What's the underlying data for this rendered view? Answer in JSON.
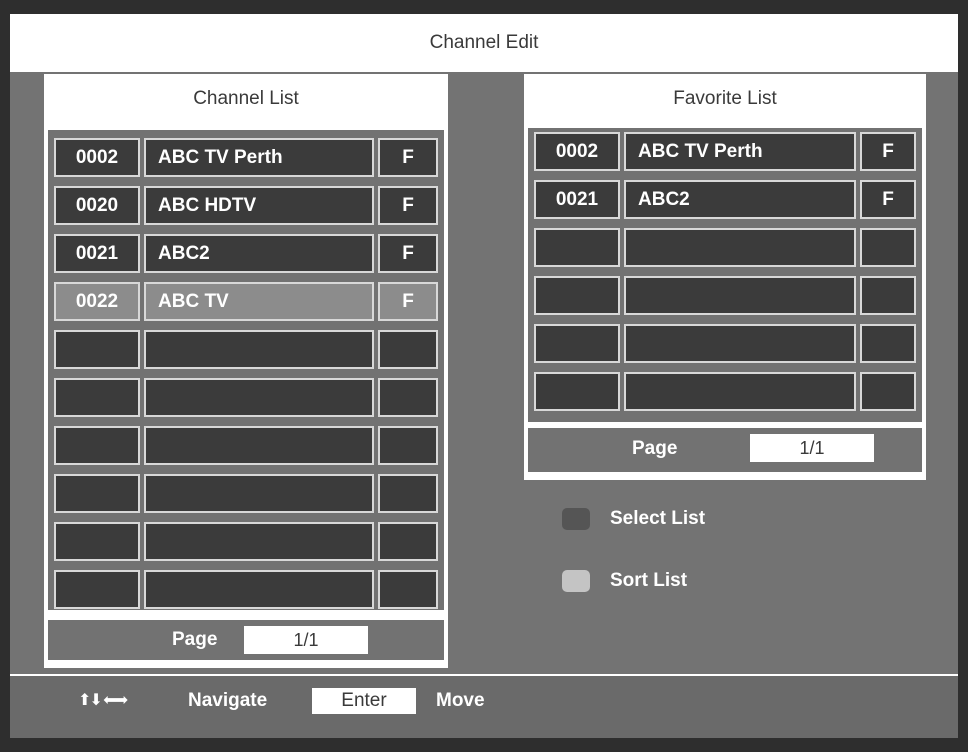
{
  "title": "Channel Edit",
  "channel_list": {
    "header": "Channel List",
    "rows": [
      {
        "num": "0002",
        "name": "ABC TV Perth",
        "fav": "F",
        "selected": false
      },
      {
        "num": "0020",
        "name": "ABC HDTV",
        "fav": "F",
        "selected": false
      },
      {
        "num": "0021",
        "name": "ABC2",
        "fav": "F",
        "selected": false
      },
      {
        "num": "0022",
        "name": "ABC TV",
        "fav": "F",
        "selected": true
      },
      {
        "num": "",
        "name": "",
        "fav": "",
        "selected": false
      },
      {
        "num": "",
        "name": "",
        "fav": "",
        "selected": false
      },
      {
        "num": "",
        "name": "",
        "fav": "",
        "selected": false
      },
      {
        "num": "",
        "name": "",
        "fav": "",
        "selected": false
      },
      {
        "num": "",
        "name": "",
        "fav": "",
        "selected": false
      },
      {
        "num": "",
        "name": "",
        "fav": "",
        "selected": false
      }
    ],
    "page_label": "Page",
    "page_value": "1/1"
  },
  "favorite_list": {
    "header": "Favorite List",
    "rows": [
      {
        "num": "0002",
        "name": "ABC TV Perth",
        "fav": "F",
        "selected": false
      },
      {
        "num": "0021",
        "name": "ABC2",
        "fav": "F",
        "selected": false
      },
      {
        "num": "",
        "name": "",
        "fav": "",
        "selected": false
      },
      {
        "num": "",
        "name": "",
        "fav": "",
        "selected": false
      },
      {
        "num": "",
        "name": "",
        "fav": "",
        "selected": false
      },
      {
        "num": "",
        "name": "",
        "fav": "",
        "selected": false
      }
    ],
    "page_label": "Page",
    "page_value": "1/1"
  },
  "legend": [
    {
      "label": "Select List",
      "color": "#555555",
      "icon": "dark-gray-key-icon"
    },
    {
      "label": "Sort List",
      "color": "#c4c4c4",
      "icon": "light-gray-key-icon"
    }
  ],
  "footer": {
    "arrows": "⬆⬇ ⬅➡",
    "navigate_label": "Navigate",
    "enter_label": "Enter",
    "move_label": "Move"
  }
}
